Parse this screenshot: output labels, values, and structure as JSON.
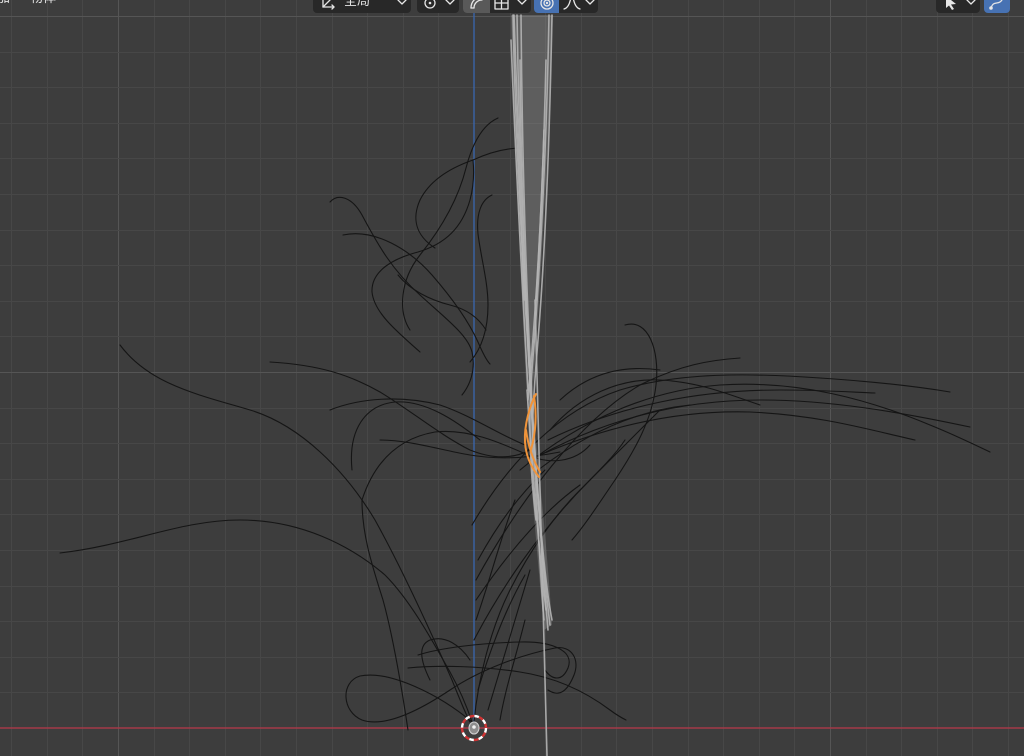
{
  "header": {
    "menus": [
      {
        "label": "加"
      },
      {
        "label": "物体"
      }
    ],
    "transform_orientation": {
      "label": "全局",
      "icon": "transform-orientation-icon"
    },
    "pivot_point": {
      "icon": "pivot-point-icon"
    },
    "snapping": {
      "active": true,
      "icon": "snap-icon",
      "target_icon": "snap-increment-icon"
    },
    "proportional_editing": {
      "active": true,
      "icon": "proportional-editing-icon",
      "falloff_icon": "falloff-icon"
    },
    "select_mode": {
      "icon": "select-tool-icon"
    },
    "curve_edit_toggle": {
      "active": true,
      "icon": "curve-edit-icon"
    }
  },
  "viewport": {
    "colors": {
      "background": "#3d3d3d",
      "grid_minor": "#474747",
      "grid_major": "#555555",
      "x_axis": "#a33a48",
      "z_axis": "#3a64a8",
      "curve": "#151515",
      "hair": "#b4b4b4",
      "selected": "#f0943a",
      "accent": "#4772b3"
    }
  }
}
